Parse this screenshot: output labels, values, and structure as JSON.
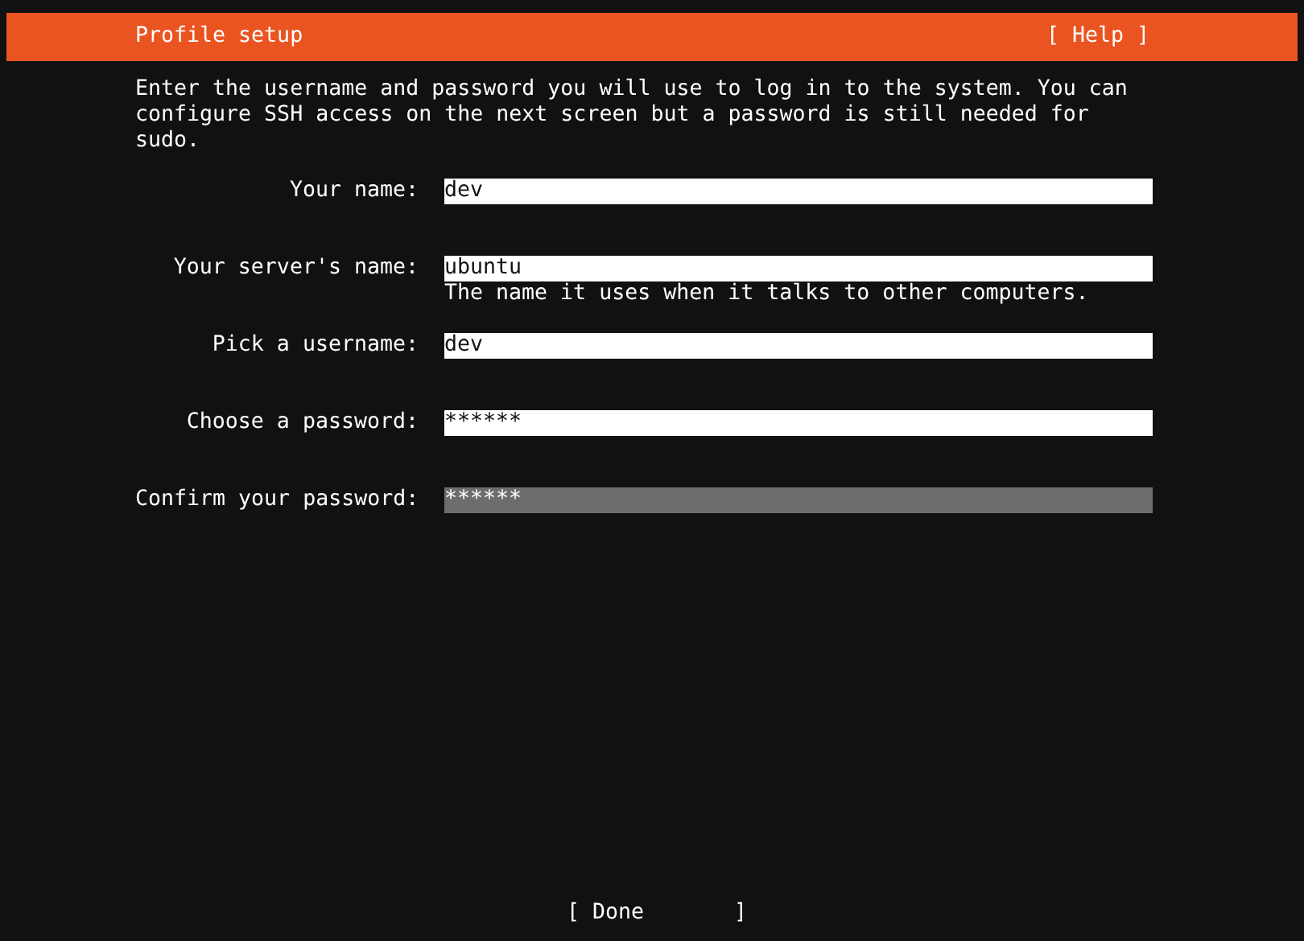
{
  "header": {
    "title": "Profile setup",
    "help": "[ Help ]"
  },
  "description": "Enter the username and password you will use to log in to the system. You can configure SSH access on the next screen but a password is still needed for sudo.",
  "fields": [
    {
      "label": "Your name:",
      "value": "dev",
      "focused": false
    },
    {
      "label": "Your server's name:",
      "value": "ubuntu",
      "hint": "The name it uses when it talks to other computers.",
      "focused": false
    },
    {
      "label": "Pick a username:",
      "value": "dev",
      "focused": false
    },
    {
      "label": "Choose a password:",
      "value": "******",
      "focused": false
    },
    {
      "label": "Confirm your password:",
      "value": "******",
      "focused": true
    }
  ],
  "done_button": "[ Done       ]"
}
